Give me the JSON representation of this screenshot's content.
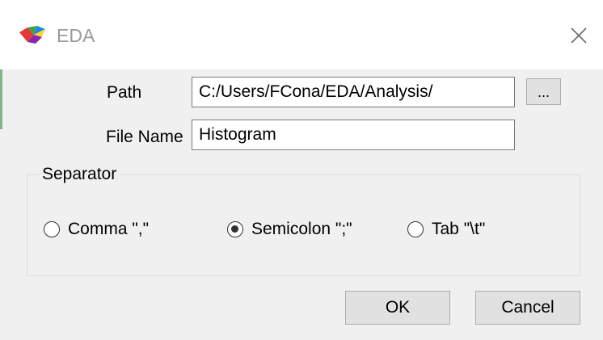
{
  "window": {
    "title": "EDA",
    "icon": "eda-logo-icon",
    "close_icon": "close-icon"
  },
  "form": {
    "path_label": "Path",
    "path_value": "C:/Users/FCona/EDA/Analysis/",
    "browse_label": "...",
    "file_name_label": "File Name",
    "file_name_value": "Histogram"
  },
  "separator": {
    "title": "Separator",
    "options": [
      {
        "label": "Comma \",\"",
        "checked": false
      },
      {
        "label": "Semicolon \";\"",
        "checked": true
      },
      {
        "label": "Tab \"\\t\"",
        "checked": false
      }
    ]
  },
  "buttons": {
    "ok_label": "OK",
    "cancel_label": "Cancel"
  }
}
